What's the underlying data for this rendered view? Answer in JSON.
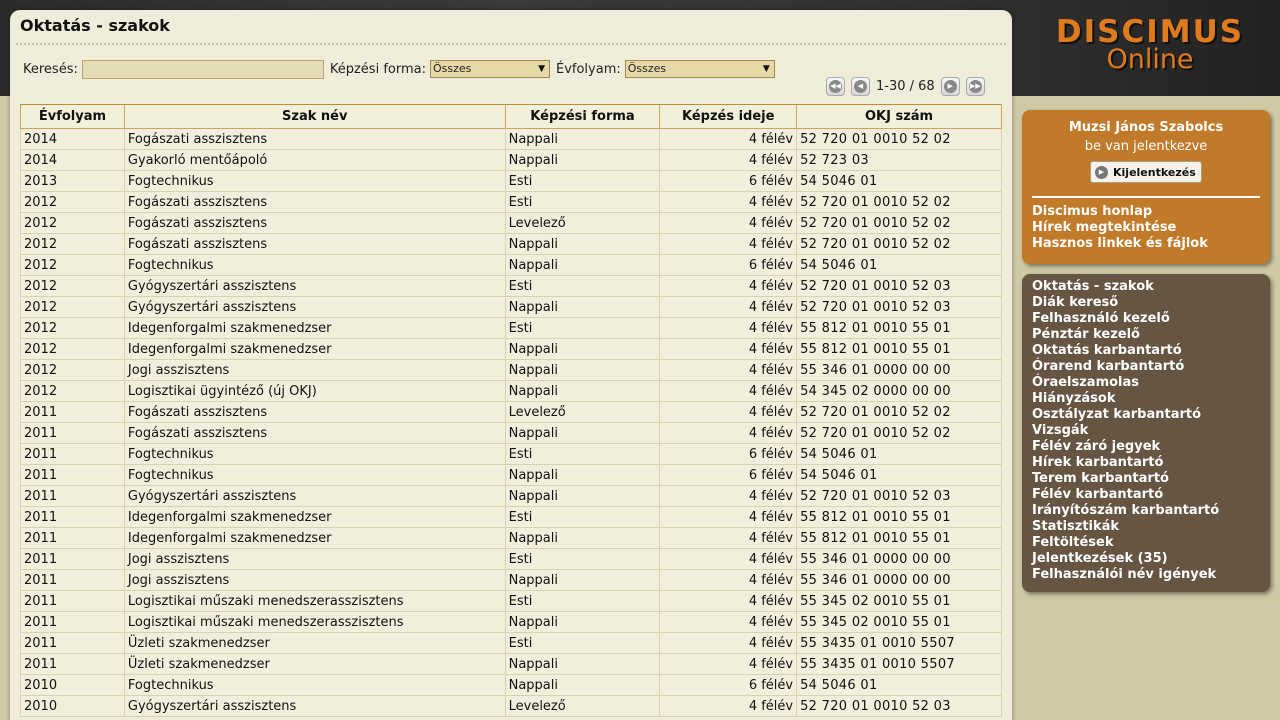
{
  "logo": {
    "line1": "DISCIMUS",
    "line2": "Online"
  },
  "page": {
    "title": "Oktatás - szakok"
  },
  "filters": {
    "search_label": "Keresés:",
    "search_value": "",
    "form_label": "Képzési forma:",
    "form_value": "Összes",
    "year_label": "Évfolyam:",
    "year_value": "Összes"
  },
  "pager": {
    "text": "1-30 / 68"
  },
  "table": {
    "headers": [
      "Évfolyam",
      "Szak név",
      "Képzési forma",
      "Képzés ideje",
      "OKJ szám"
    ],
    "rows": [
      [
        "2014",
        "Fogászati asszisztens",
        "Nappali",
        "4 félév",
        "52 720 01 0010 52 02"
      ],
      [
        "2014",
        "Gyakorló mentőápoló",
        "Nappali",
        "4 félév",
        "52 723 03"
      ],
      [
        "2013",
        "Fogtechnikus",
        "Esti",
        "6 félév",
        "54 5046 01"
      ],
      [
        "2012",
        "Fogászati asszisztens",
        "Esti",
        "4 félév",
        "52 720 01 0010 52 02"
      ],
      [
        "2012",
        "Fogászati asszisztens",
        "Levelező",
        "4 félév",
        "52 720 01 0010 52 02"
      ],
      [
        "2012",
        "Fogászati asszisztens",
        "Nappali",
        "4 félév",
        "52 720 01 0010 52 02"
      ],
      [
        "2012",
        "Fogtechnikus",
        "Nappali",
        "6 félév",
        "54 5046 01"
      ],
      [
        "2012",
        "Gyógyszertári asszisztens",
        "Esti",
        "4 félév",
        "52 720 01 0010 52 03"
      ],
      [
        "2012",
        "Gyógyszertári asszisztens",
        "Nappali",
        "4 félév",
        "52 720 01 0010 52 03"
      ],
      [
        "2012",
        "Idegenforgalmi szakmenedzser",
        "Esti",
        "4 félév",
        "55 812 01 0010 55 01"
      ],
      [
        "2012",
        "Idegenforgalmi szakmenedzser",
        "Nappali",
        "4 félév",
        "55 812 01 0010 55 01"
      ],
      [
        "2012",
        "Jogi asszisztens",
        "Nappali",
        "4 félév",
        "55 346 01 0000 00 00"
      ],
      [
        "2012",
        "Logisztikai ügyintéző (új OKJ)",
        "Nappali",
        "4 félév",
        "54 345 02 0000 00 00"
      ],
      [
        "2011",
        "Fogászati asszisztens",
        "Levelező",
        "4 félév",
        "52 720 01 0010 52 02"
      ],
      [
        "2011",
        "Fogászati asszisztens",
        "Nappali",
        "4 félév",
        "52 720 01 0010 52 02"
      ],
      [
        "2011",
        "Fogtechnikus",
        "Esti",
        "6 félév",
        "54 5046 01"
      ],
      [
        "2011",
        "Fogtechnikus",
        "Nappali",
        "6 félév",
        "54 5046 01"
      ],
      [
        "2011",
        "Gyógyszertári asszisztens",
        "Nappali",
        "4 félév",
        "52 720 01 0010 52 03"
      ],
      [
        "2011",
        "Idegenforgalmi szakmenedzser",
        "Esti",
        "4 félév",
        "55 812 01 0010 55 01"
      ],
      [
        "2011",
        "Idegenforgalmi szakmenedzser",
        "Nappali",
        "4 félév",
        "55 812 01 0010 55 01"
      ],
      [
        "2011",
        "Jogi asszisztens",
        "Esti",
        "4 félév",
        "55 346 01 0000 00 00"
      ],
      [
        "2011",
        "Jogi asszisztens",
        "Nappali",
        "4 félév",
        "55 346 01 0000 00 00"
      ],
      [
        "2011",
        "Logisztikai műszaki menedszerasszisztens",
        "Esti",
        "4 félév",
        "55 345 02 0010 55 01"
      ],
      [
        "2011",
        "Logisztikai műszaki menedszerasszisztens",
        "Nappali",
        "4 félév",
        "55 345 02 0010 55 01"
      ],
      [
        "2011",
        "Üzleti szakmenedzser",
        "Esti",
        "4 félév",
        "55 3435 01 0010 5507"
      ],
      [
        "2011",
        "Üzleti szakmenedzser",
        "Nappali",
        "4 félév",
        "55 3435 01 0010 5507"
      ],
      [
        "2010",
        "Fogtechnikus",
        "Nappali",
        "6 félév",
        "54 5046 01"
      ],
      [
        "2010",
        "Gyógyszertári asszisztens",
        "Levelező",
        "4 félév",
        "52 720 01 0010 52 03"
      ]
    ]
  },
  "user": {
    "name": "Muzsi János Szabolcs",
    "state": "be van jelentkezve",
    "logout_label": "Kijelentkezés"
  },
  "links_top": [
    "Discimus honlap",
    "Hírek megtekintése",
    "Hasznos linkek és fájlok"
  ],
  "links_menu": [
    "Oktatás - szakok",
    "Diák kereső",
    "Felhasználó kezelő",
    "Pénztár kezelő",
    "Oktatás karbantartó",
    "Órarend karbantartó",
    "Óraelszamolas",
    "Hiányzások",
    "Osztályzat karbantartó",
    "Vizsgák",
    "Félév záró jegyek",
    "Hírek karbantartó",
    "Terem karbantartó",
    "Félév karbantartó",
    "Irányítószám karbantartó",
    "Statisztikák",
    "Feltöltések",
    "Jelentkezések (35)",
    "Felhasználói név igények"
  ],
  "colors": {
    "accent_orange": "#e07a1e",
    "user_box": "#c07a2a",
    "menu_box": "#665543"
  }
}
